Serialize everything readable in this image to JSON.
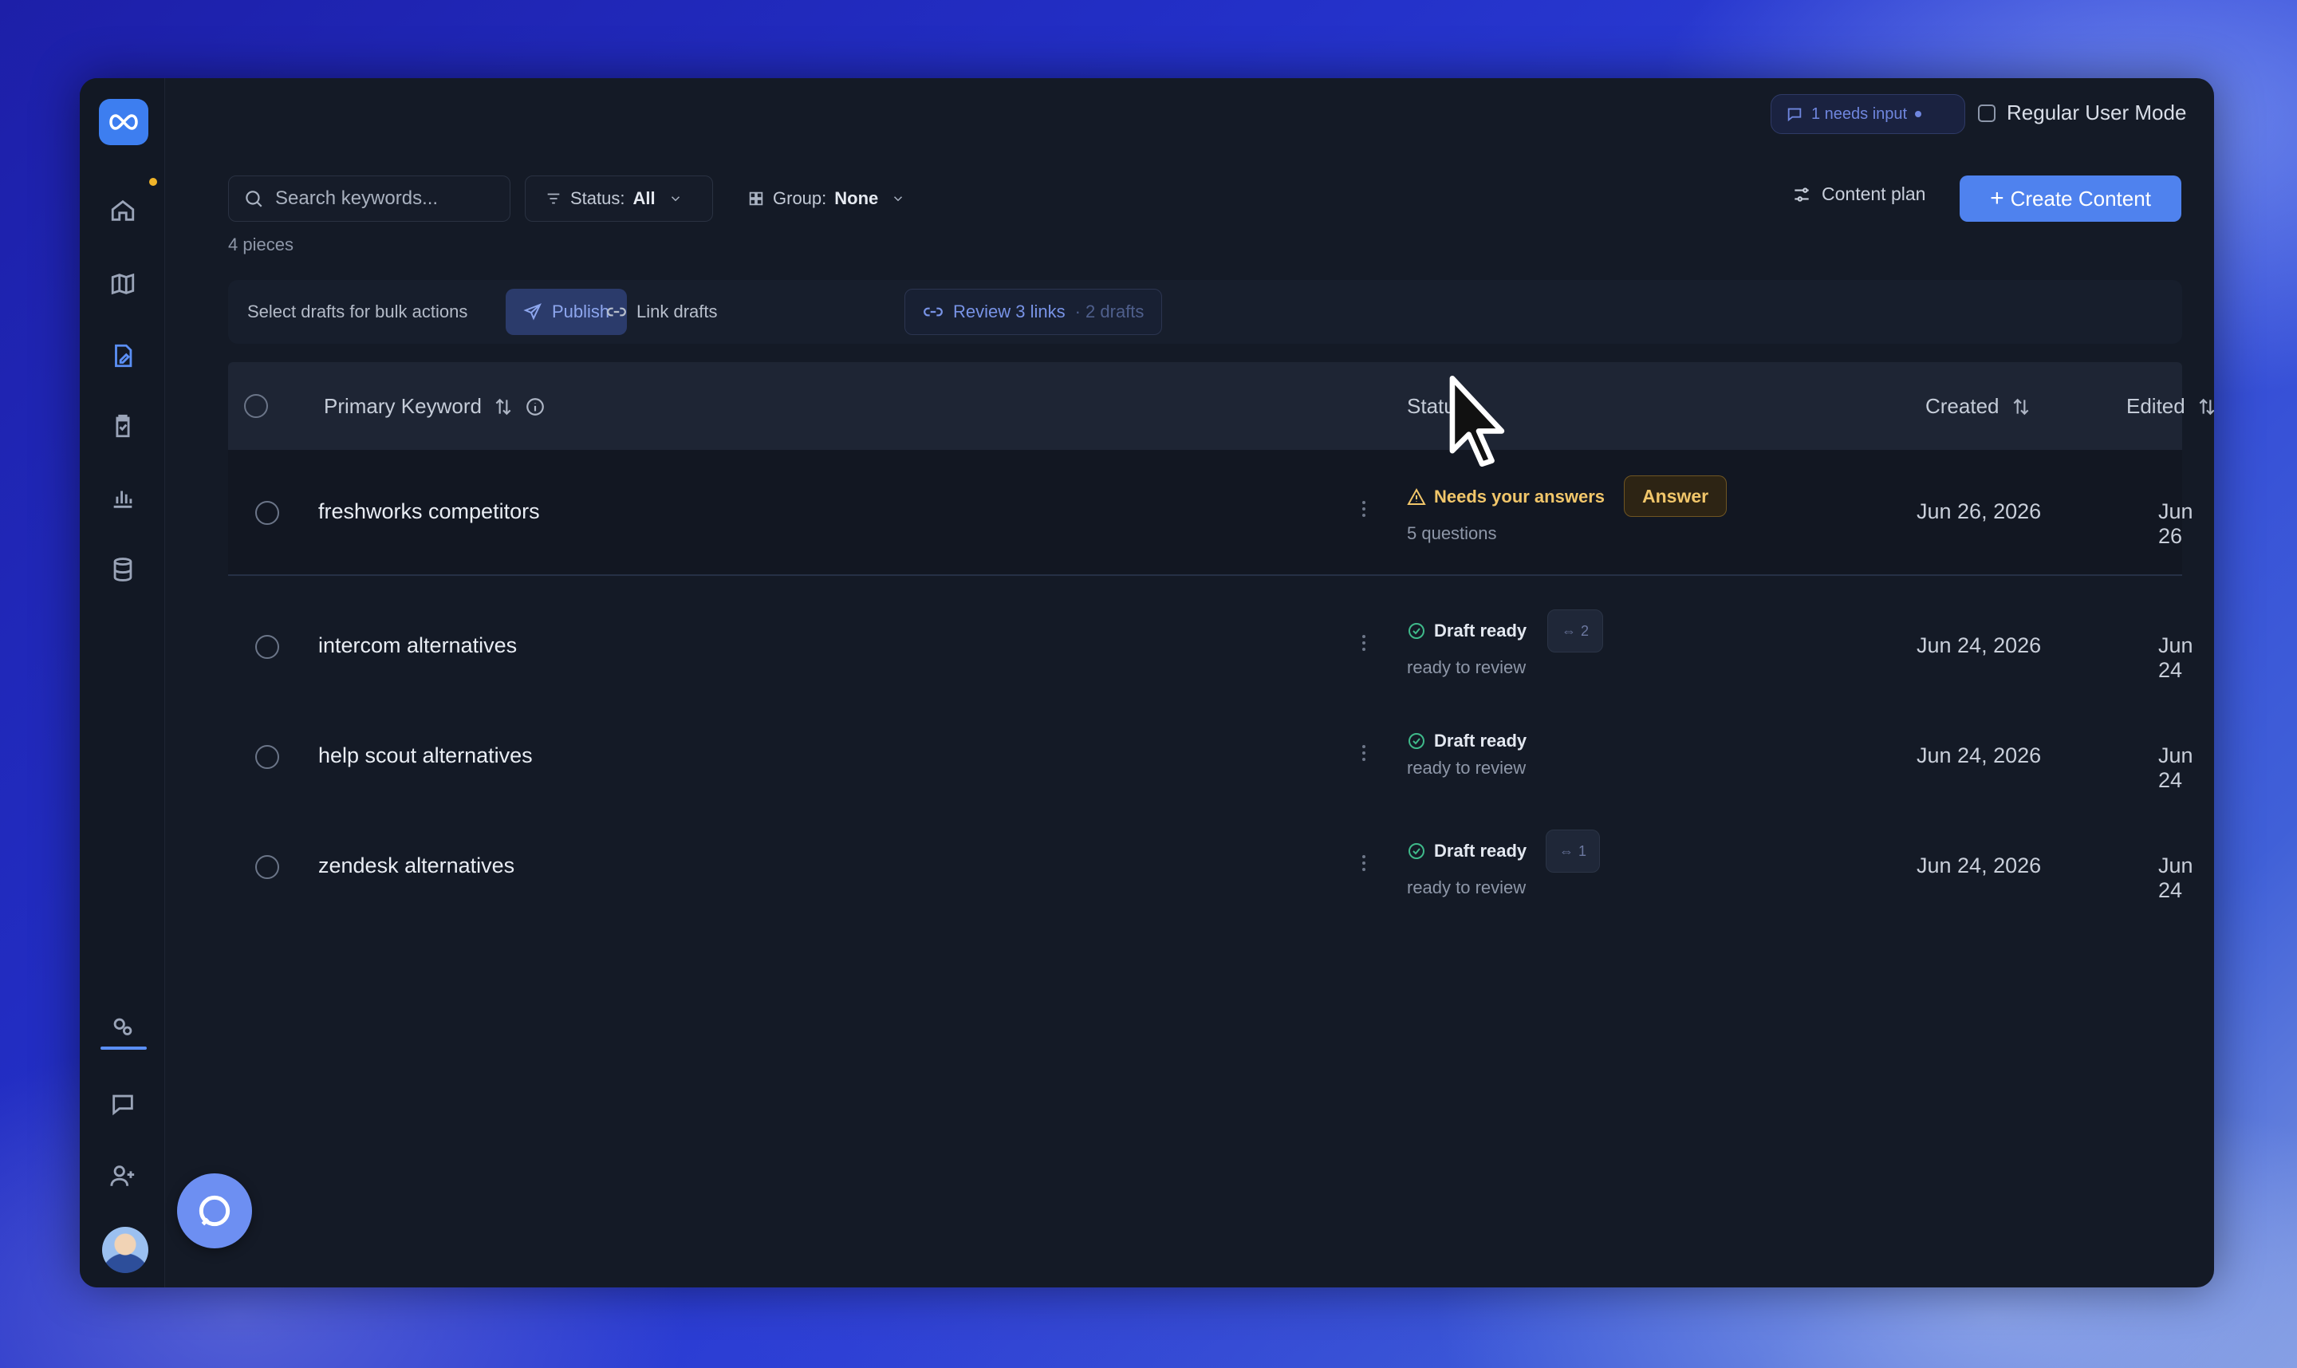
{
  "topbar": {
    "needs_input": "1 needs input",
    "regular_mode_label": "Regular User Mode"
  },
  "toolbar": {
    "search_placeholder": "Search keywords...",
    "status_label": "Status:",
    "status_value": "All",
    "group_label": "Group:",
    "group_value": "None",
    "pieces": "4 pieces",
    "content_plan": "Content plan",
    "create_content": "Create Content",
    "create_plus": "+"
  },
  "bulk": {
    "label": "Select drafts for bulk actions",
    "publish": "Publish",
    "link_drafts": "Link drafts",
    "review_links": "Review 3 links",
    "review_suffix": "· 2 drafts"
  },
  "table": {
    "headers": {
      "keyword": "Primary Keyword",
      "status": "Status",
      "created": "Created",
      "edited": "Edited"
    },
    "rows": [
      {
        "keyword": "freshworks competitors",
        "status": "Needs your answers",
        "status_sub": "5 questions",
        "action": "Answer",
        "created": "Jun 26, 2026",
        "edited": "Jun 26"
      },
      {
        "keyword": "intercom alternatives",
        "status": "Draft ready",
        "status_sub": "ready to review",
        "links": "2",
        "created": "Jun 24, 2026",
        "edited": "Jun 24"
      },
      {
        "keyword": "help scout alternatives",
        "status": "Draft ready",
        "status_sub": "ready to review",
        "created": "Jun 24, 2026",
        "edited": "Jun 24"
      },
      {
        "keyword": "zendesk alternatives",
        "status": "Draft ready",
        "status_sub": "ready to review",
        "links": "1",
        "created": "Jun 24, 2026",
        "edited": "Jun 24"
      }
    ]
  },
  "colors": {
    "accent": "#4f82ee",
    "warning": "#f1c66a",
    "success": "#3fb98a",
    "panel": "#141a26"
  },
  "icons": [
    "logo-icon",
    "home-icon",
    "map-icon",
    "document-edit-icon",
    "clipboard-icon",
    "bar-chart-icon",
    "database-icon",
    "integrations-icon",
    "chat-icon",
    "add-user-icon",
    "gear-icon",
    "search-icon",
    "filter-icon",
    "grid-icon",
    "chevron-down-icon",
    "send-icon",
    "link-icon",
    "sort-icon",
    "info-icon",
    "warning-icon",
    "check-circle-icon",
    "kebab-icon",
    "cursor-icon"
  ]
}
